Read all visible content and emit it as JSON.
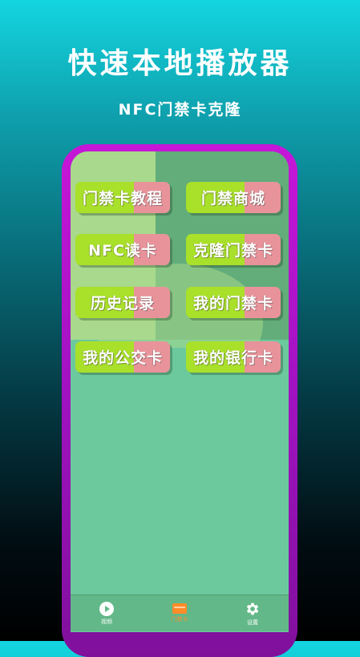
{
  "promo": {
    "title": "快速本地播放器",
    "subtitle": "NFC门禁卡克隆"
  },
  "menu": {
    "items": [
      {
        "label": "门禁卡教程"
      },
      {
        "label": "门禁商城"
      },
      {
        "label": "NFC读卡"
      },
      {
        "label": "克隆门禁卡"
      },
      {
        "label": "历史记录"
      },
      {
        "label": "我的门禁卡"
      },
      {
        "label": "我的公交卡"
      },
      {
        "label": "我的银行卡"
      }
    ]
  },
  "bottom_nav": {
    "items": [
      {
        "label": "视频",
        "icon": "play-icon"
      },
      {
        "label": "门禁卡",
        "icon": "card-icon",
        "active": true
      },
      {
        "label": "设置",
        "icon": "gear-icon"
      }
    ]
  },
  "colors": {
    "button_green": "#a9e02a",
    "button_pink": "#e8939a",
    "frame_purple": "#c616d8",
    "screen_green": "#6cc99e",
    "active_orange": "#ff8c2a"
  }
}
